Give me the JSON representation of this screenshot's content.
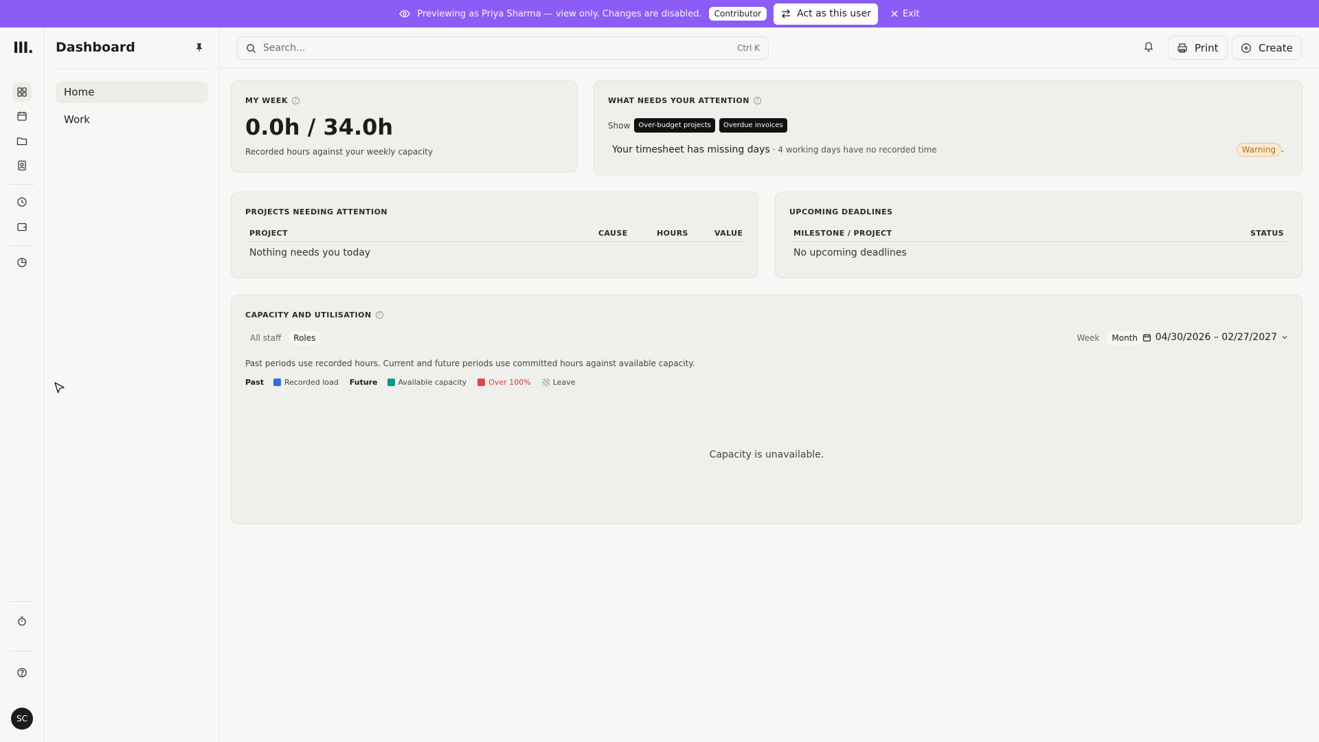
{
  "banner": {
    "message": "Previewing as Priya Sharma — view only. Changes are disabled.",
    "role": "Contributor",
    "act_label": "Act as this user",
    "exit_label": "Exit",
    "bg_color": "#8b5cf6"
  },
  "rail": {
    "logo": "III.",
    "icons": [
      "dashboard-icon",
      "calendar-icon",
      "folder-icon",
      "contacts-icon",
      "clock-icon",
      "wallet-icon",
      "pie-chart-icon",
      "timer-icon",
      "help-icon"
    ],
    "avatar_initials": "SC"
  },
  "sidebar": {
    "title": "Dashboard",
    "items": [
      {
        "label": "Home",
        "active": true
      },
      {
        "label": "Work",
        "active": false
      }
    ]
  },
  "topbar": {
    "search_placeholder": "Search...",
    "search_shortcut": "Ctrl K",
    "print_label": "Print",
    "create_label": "Create"
  },
  "my_week": {
    "heading": "MY WEEK",
    "value": "0.0h / 34.0h",
    "caption": "Recorded hours against your weekly capacity"
  },
  "attention": {
    "heading": "WHAT NEEDS YOUR ATTENTION",
    "show_label": "Show",
    "filters": [
      "Over-budget projects",
      "Overdue invoices"
    ],
    "alert_title": "Your timesheet has missing days",
    "alert_detail": "· 4 working days have no recorded time",
    "alert_badge": "Warning",
    "trailing": "."
  },
  "projects": {
    "heading": "PROJECTS NEEDING ATTENTION",
    "columns": [
      "PROJECT",
      "CAUSE",
      "HOURS",
      "VALUE"
    ],
    "empty": "Nothing needs you today"
  },
  "deadlines": {
    "heading": "UPCOMING DEADLINES",
    "columns": [
      "MILESTONE / PROJECT",
      "STATUS"
    ],
    "empty": "No upcoming deadlines"
  },
  "capacity": {
    "heading": "CAPACITY AND UTILISATION",
    "views": [
      {
        "label": "All staff",
        "active": false
      },
      {
        "label": "Roles",
        "active": true
      }
    ],
    "periods": [
      {
        "label": "Week",
        "active": false
      },
      {
        "label": "Month",
        "active": true
      }
    ],
    "date_range": "04/30/2026 – 02/27/2027",
    "note": "Past periods use recorded hours. Current and future periods use committed hours against available capacity.",
    "legend": {
      "past_label": "Past",
      "recorded": {
        "label": "Recorded load",
        "color": "#2f6fd6"
      },
      "future_label": "Future",
      "available": {
        "label": "Available capacity",
        "color": "#0f9488"
      },
      "over": {
        "label": "Over 100%",
        "color": "#e04444"
      },
      "leave": {
        "label": "Leave",
        "color": "#9bbfa5"
      }
    },
    "unavailable": "Capacity is unavailable."
  }
}
